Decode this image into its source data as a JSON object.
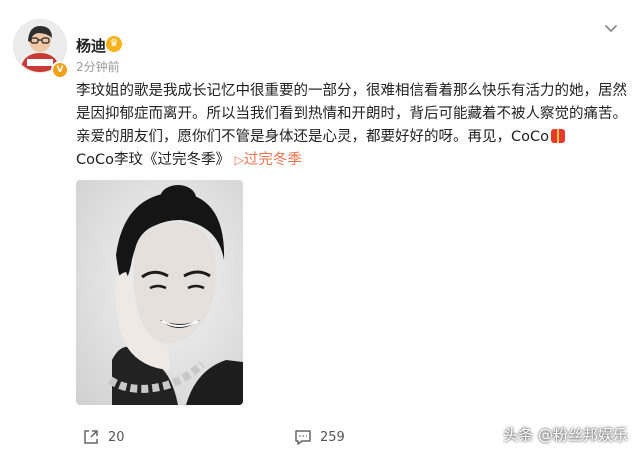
{
  "post": {
    "author": "杨迪",
    "time": "2分钟前",
    "lines": [
      "李玟姐的歌是我成长记忆中很重要的一部分，很难相信看着那么快乐有活力的她，居然",
      "是因抑郁症而离开。所以当我们看到热情和开朗时，背后可能藏着不被人察觉的痛苦。",
      "亲爱的朋友们，愿你们不管是身体还是心灵，都要好好的呀。再见，CoCo"
    ],
    "song": {
      "label": "CoCo李玟《过完冬季》",
      "play_label": "过完冬季"
    }
  },
  "footer": {
    "share_count": "20",
    "comment_count": "259"
  },
  "watermark": "头条 @粉丝邦娱乐",
  "colors": {
    "link": "#eb7350",
    "vip": "#f6b21b"
  }
}
